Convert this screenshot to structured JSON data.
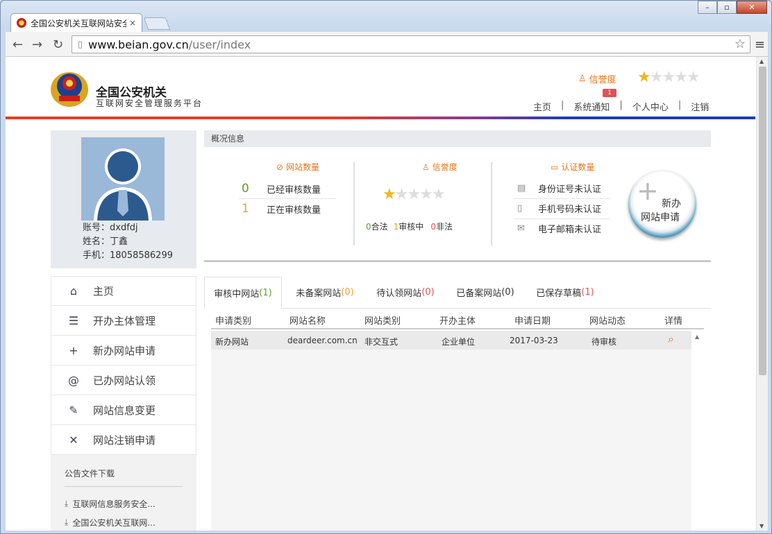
{
  "browser": {
    "tab_title": "全国公安机关互联网站安全",
    "tab_close": "×",
    "url_host": "www.beian.gov.cn",
    "url_path": "/user/index"
  },
  "header": {
    "logo_title": "全国公安机关",
    "logo_subtitle": "互联网安全管理服务平台",
    "credit_label": "信誉度",
    "credit_stars": {
      "filled": 1,
      "total": 5
    },
    "notice_badge": "1",
    "nav": [
      "主页",
      "系统通知",
      "个人中心",
      "注销"
    ]
  },
  "profile": {
    "account": "账号：dxdfdj",
    "name": "姓名：丁鑫",
    "phone": "手机：18058586299"
  },
  "sidebar": {
    "items": [
      {
        "label": "主页",
        "icon": "home-icon"
      },
      {
        "label": "开办主体管理",
        "icon": "list-icon"
      },
      {
        "label": "新办网站申请",
        "icon": "plus-icon"
      },
      {
        "label": "已办网站认领",
        "icon": "at-icon"
      },
      {
        "label": "网站信息变更",
        "icon": "edit-icon"
      },
      {
        "label": "网站注销申请",
        "icon": "close-icon"
      }
    ]
  },
  "notice": {
    "title": "公告文件下载",
    "files": [
      "互联网信息服务安全...",
      "全国公安机关互联网..."
    ]
  },
  "overview": {
    "title": "概况信息",
    "site_count": {
      "title": "网站数量",
      "rows": [
        {
          "num": "0",
          "label": "已经审核数量",
          "color": "#5aa02c"
        },
        {
          "num": "1",
          "label": "正在审核数量",
          "color": "#f0a030"
        }
      ]
    },
    "credit": {
      "title": "信誉度",
      "stars": {
        "filled": 1,
        "total": 5
      },
      "stats": [
        {
          "num": "0",
          "label": "合法",
          "color": "#5aa02c"
        },
        {
          "num": "1",
          "label": "审核中",
          "color": "#f0a030"
        },
        {
          "num": "0",
          "label": "非法",
          "color": "#e05353"
        }
      ]
    },
    "auth": {
      "title": "认证数量",
      "rows": [
        "身份证号未认证",
        "手机号码未认证",
        "电子邮箱未认证"
      ]
    },
    "new_button": {
      "line1": "新办",
      "line2": "网站申请"
    }
  },
  "tabs": [
    {
      "label": "审核中网站",
      "count": "(1)",
      "count_color": "#5aa02c",
      "active": true
    },
    {
      "label": "未备案网站",
      "count": "(0)",
      "count_color": "#f0a030",
      "active": false
    },
    {
      "label": "待认领网站",
      "count": "(0)",
      "count_color": "#e05353",
      "active": false
    },
    {
      "label": "已备案网站",
      "count": "(0)",
      "count_color": "#333333",
      "active": false
    },
    {
      "label": "已保存草稿",
      "count": "(1)",
      "count_color": "#e05353",
      "active": false
    }
  ],
  "table": {
    "headers": [
      "申请类别",
      "网站名称",
      "网站类别",
      "开办主体",
      "申请日期",
      "网站动态",
      "详情"
    ],
    "rows": [
      [
        "新办网站",
        "deardeer.com.cn",
        "非交互式",
        "企业单位",
        "2017-03-23",
        "待审核"
      ]
    ]
  }
}
